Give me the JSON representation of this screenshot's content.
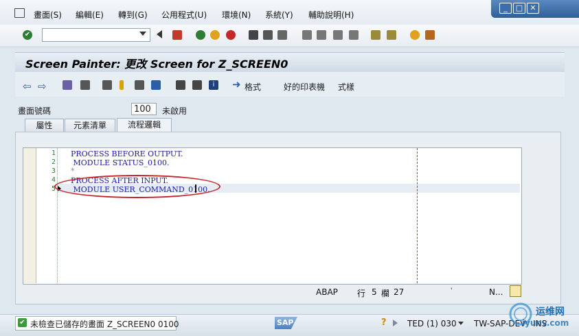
{
  "menu": {
    "items": [
      "畫面(S)",
      "編輯(E)",
      "轉到(G)",
      "公用程式(U)",
      "環境(N)",
      "系統(Y)",
      "輔助說明(H)"
    ]
  },
  "window_controls": [
    "minimize",
    "maximize",
    "close"
  ],
  "command_field": {
    "value": ""
  },
  "title": "Screen Painter: 更改 Screen for Z_SCREEN0",
  "app_toolbar": {
    "layout_label": "格式",
    "print_label": "好的印表機",
    "pattern_label": "式樣"
  },
  "screen": {
    "label": "畫面號碼",
    "number": "100",
    "status": "未啟用"
  },
  "tabs": [
    {
      "label": "屬性",
      "active": false
    },
    {
      "label": "元素清單",
      "active": false
    },
    {
      "label": "流程邏輯",
      "active": true
    }
  ],
  "editor": {
    "lines": [
      {
        "no": "1",
        "text": "PROCESS BEFORE OUTPUT."
      },
      {
        "no": "2",
        "text": " MODULE STATUS_0100."
      },
      {
        "no": "3",
        "text": "*"
      },
      {
        "no": "4",
        "text": "PROCESS AFTER INPUT."
      },
      {
        "no": "5",
        "text": " MODULE USER_COMMAND_0100."
      }
    ],
    "language": "ABAP",
    "row_label": "行",
    "row": "5",
    "col_label": "欄",
    "col": "27",
    "mode": "N..."
  },
  "status": {
    "message": "未檢查已儲存的畫面 Z_SCREEN0 0100",
    "logo": "SAP",
    "session": "TED (1) 030",
    "server": "TW-SAP-DEV",
    "ins": "INS"
  },
  "watermark": {
    "text": "运维网",
    "sub": "iyunv.com"
  },
  "colors": {
    "code": "#1a1aa0",
    "line_numbers": "#2d7a2d",
    "annotation": "#c8232a"
  }
}
